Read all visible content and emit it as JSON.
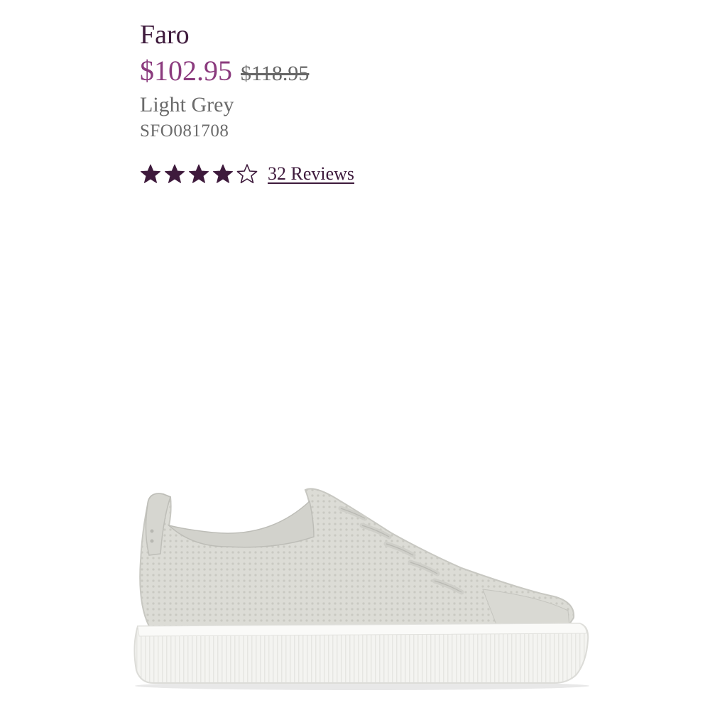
{
  "product": {
    "title": "Faro",
    "price_sale": "$102.95",
    "price_original": "$118.95",
    "color": "Light Grey",
    "sku": "SFO081708",
    "rating": 4,
    "rating_max": 5,
    "reviews_label": "32 Reviews"
  },
  "colors": {
    "title": "#3e1a3c",
    "sale_price": "#8b3b7e",
    "star": "#3e1a3c",
    "muted_text": "#6b6b6b"
  },
  "image": {
    "icon": "sneaker-product-image"
  }
}
